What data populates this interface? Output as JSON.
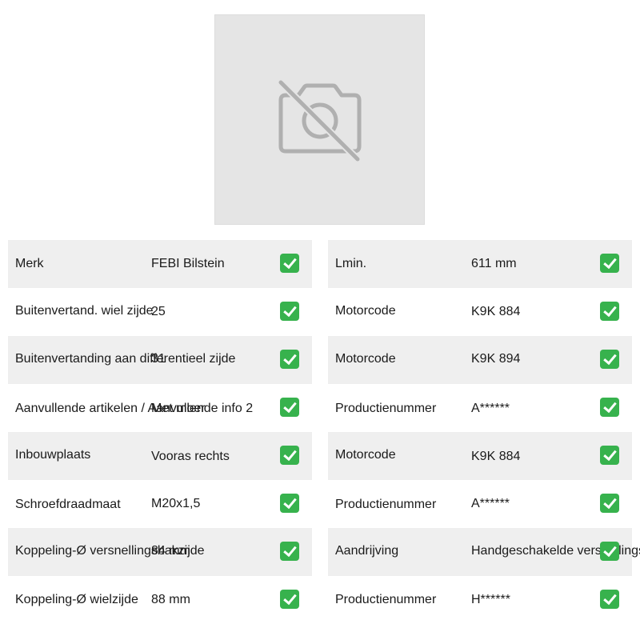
{
  "image": {
    "icon": "no-photo-icon"
  },
  "check_icon": "check-icon",
  "check_color": "#37b24d",
  "left_table": {
    "rows": [
      {
        "label": "Merk",
        "value": "FEBI Bilstein"
      },
      {
        "label": "Buitenvertand. wiel zijde",
        "value": "25"
      },
      {
        "label": "Buitenvertanding aan differentieel zijde",
        "value": "31"
      },
      {
        "label": "Aanvullende artikelen / Aanvullende info 2",
        "value": "Met moer"
      },
      {
        "label": "Inbouwplaats",
        "value": "Vooras rechts"
      },
      {
        "label": "Schroefdraadmaat",
        "value": "M20x1,5"
      },
      {
        "label": "Koppeling-Ø versnellingsbakzijde",
        "value": "84 mm"
      },
      {
        "label": "Koppeling-Ø wielzijde",
        "value": "88 mm"
      }
    ]
  },
  "right_table": {
    "rows": [
      {
        "label": "Lmin.",
        "value": "611 mm"
      },
      {
        "label": "Motorcode",
        "value": "K9K 884"
      },
      {
        "label": "Motorcode",
        "value": "K9K 894"
      },
      {
        "label": "Productienummer",
        "value": "A******"
      },
      {
        "label": "Motorcode",
        "value": "K9K 884"
      },
      {
        "label": "Productienummer",
        "value": "A******"
      },
      {
        "label": "Aandrijving",
        "value": "Handgeschakelde versnellingsbak"
      },
      {
        "label": "Productienummer",
        "value": "H******"
      }
    ]
  }
}
